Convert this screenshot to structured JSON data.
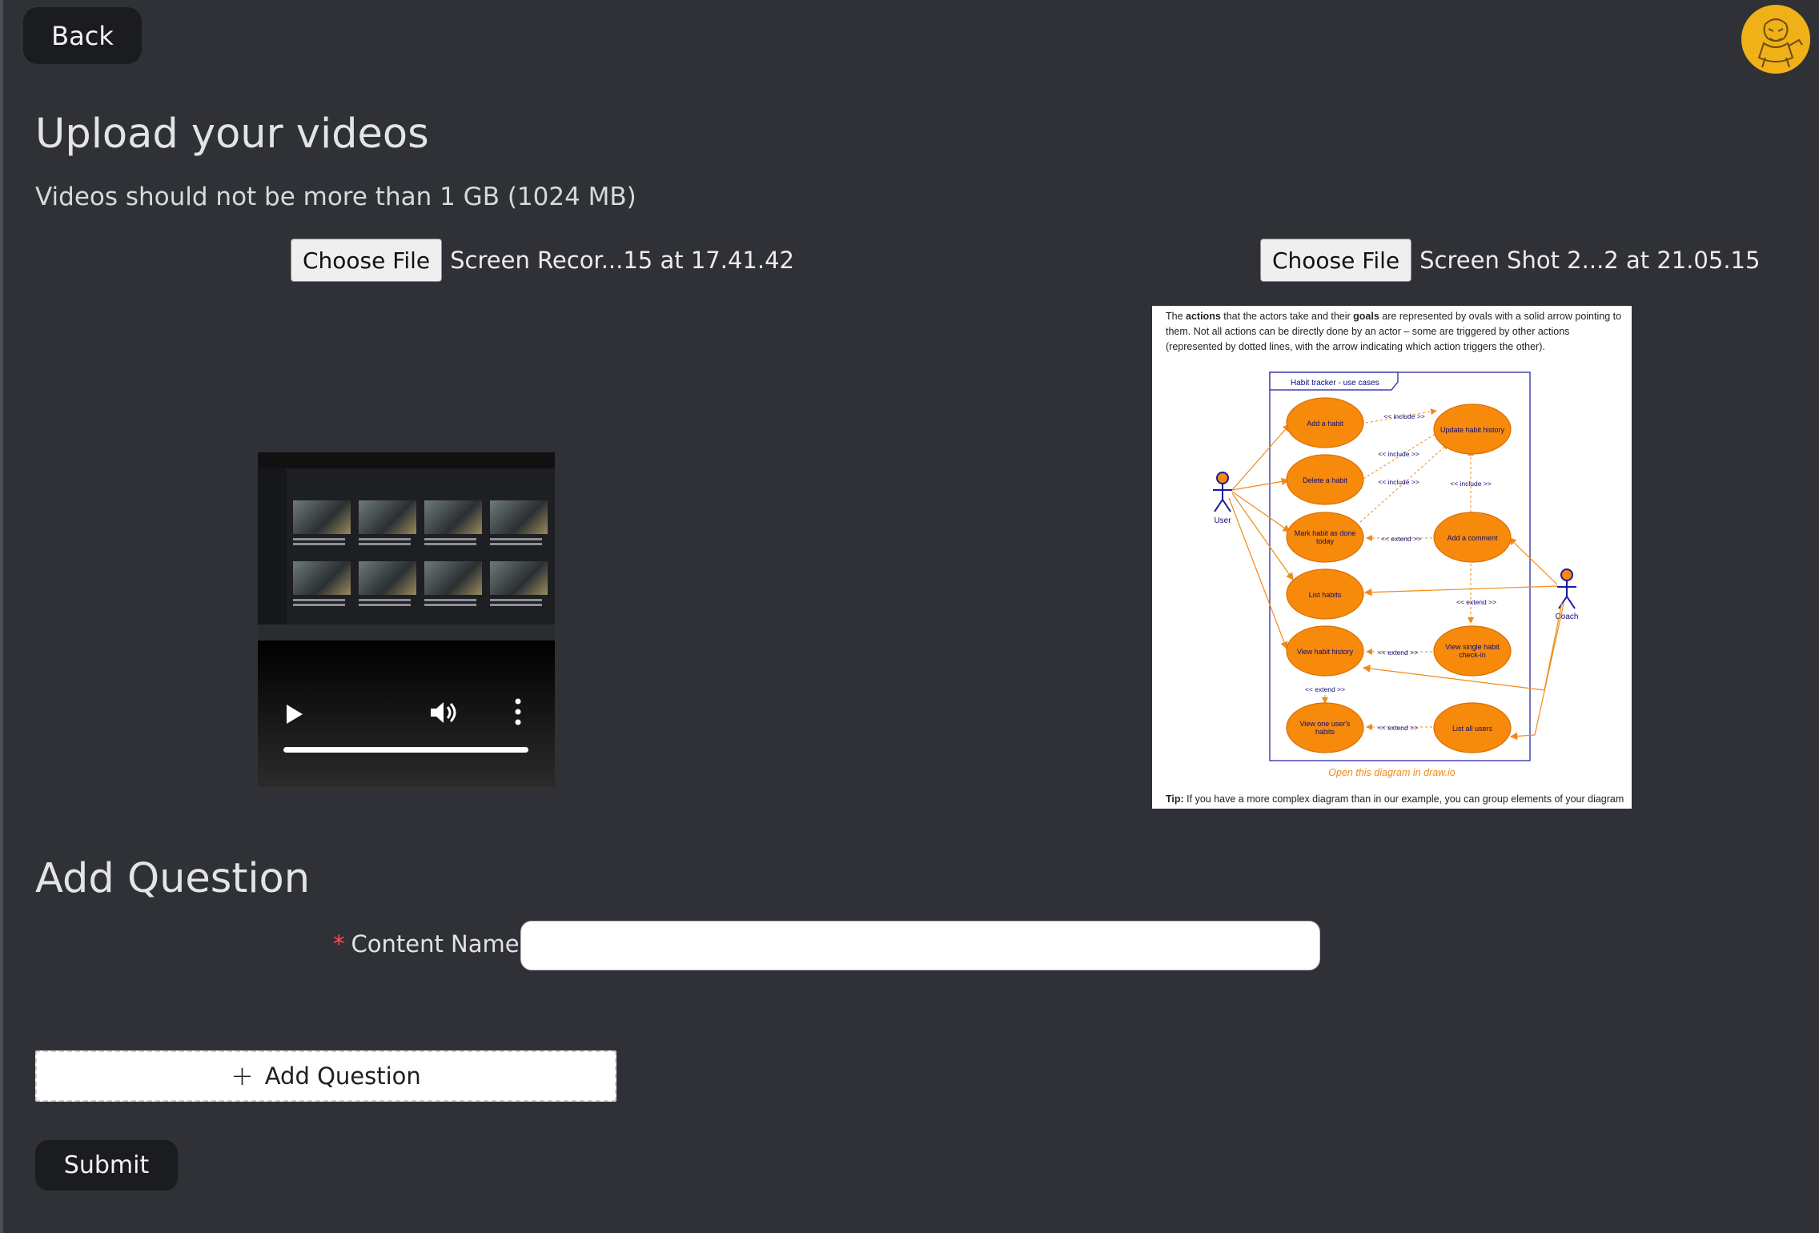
{
  "header": {
    "back_label": "Back",
    "avatar_icon": "mascot-avatar-icon"
  },
  "upload": {
    "title": "Upload your videos",
    "subtitle": "Videos should not be more than 1 GB (1024 MB)",
    "video_file": {
      "button_label": "Choose File",
      "file_name": "Screen Recor...15 at 17.41.42"
    },
    "image_file": {
      "button_label": "Choose File",
      "file_name": "Screen Shot 2...2 at 21.05.15"
    }
  },
  "diagram_preview": {
    "intro": {
      "t1": "The ",
      "b1": "actions",
      "t2": " that the actors take and their ",
      "b2": "goals",
      "t3": " are represented by ovals with a solid arrow pointing to them. Not all actions can be directly done by an actor – some are triggered by other actions (represented by dotted lines, with the arrow indicating which action triggers the other)."
    },
    "frame_title": "Habit tracker - use cases",
    "actors": [
      "User",
      "Coach"
    ],
    "use_cases": {
      "add_habit": "Add a habit",
      "update_history": "Update habit history",
      "delete_habit": "Delete a habit",
      "mark_done_1": "Mark habit as done",
      "mark_done_2": "today",
      "add_comment": "Add a comment",
      "list_habits": "List habits",
      "view_history": "View habit history",
      "view_single_1": "View single habit",
      "view_single_2": "check-in",
      "view_users_habits_1": "View one user's",
      "view_users_habits_2": "habits",
      "list_users": "List all users"
    },
    "relation_labels": {
      "include": "<< include >>",
      "extend": "<< extend >>"
    },
    "link_text": "Open this diagram in draw.io",
    "tip_label": "Tip:",
    "tip_text": " If you have a more complex diagram than in our example, you can group elements of your diagram"
  },
  "question": {
    "title": "Add Question",
    "content_name_label": "Content Name",
    "required_mark": "*",
    "content_name_value": "",
    "add_question_label": "Add Question",
    "submit_label": "Submit"
  },
  "colors": {
    "background": "#2f3137",
    "dark_button": "#1b1c20",
    "oval_fill": "#f78a0b",
    "oval_stroke": "#d86f00",
    "diagram_text": "#0b0b7a",
    "avatar_bg": "#efb018"
  }
}
